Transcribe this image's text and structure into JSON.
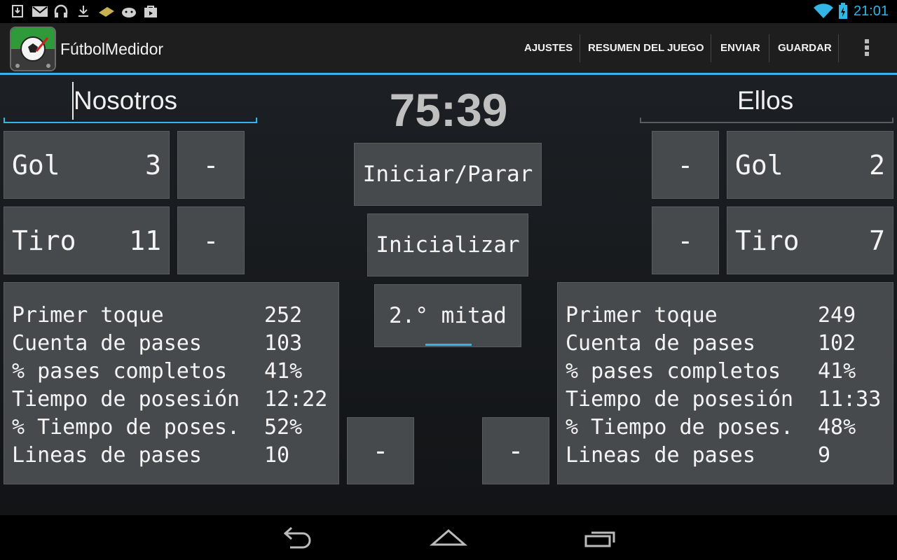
{
  "status_bar": {
    "time": "21:01",
    "left_icons": [
      "download-complete-icon",
      "gmail-icon",
      "headphones-icon",
      "download-icon",
      "mail-stack-icon",
      "android-icon",
      "shopping-bag-icon"
    ],
    "right_icons": [
      "wifi-icon",
      "battery-charging-icon"
    ]
  },
  "action_bar": {
    "title": "FútbolMedidor",
    "actions": [
      "AJUSTES",
      "RESUMEN DEL JUEGO",
      "ENVIAR",
      "GUARDAR"
    ],
    "overflow": "overflow-menu-icon"
  },
  "home": {
    "name": "Nosotros",
    "gol_label": "Gol",
    "gol": "3",
    "tiro_label": "Tiro",
    "tiro": "11",
    "minus": "-"
  },
  "away": {
    "name": "Ellos",
    "gol_label": "Gol",
    "gol": "2",
    "tiro_label": "Tiro",
    "tiro": "7",
    "minus": "-"
  },
  "center": {
    "timer": "75:39",
    "start_stop": "Iniciar/Parar",
    "reset": "Inicializar",
    "half": "2.° mitad",
    "minus_left": "-",
    "minus_right": "-"
  },
  "stats_labels": [
    "Primer toque",
    "Cuenta de pases",
    "% pases completos",
    "Tiempo de posesión",
    "% Tiempo de poses.",
    "Lineas de pases"
  ],
  "home_stats": [
    "252",
    "103",
    "41%",
    "12:22",
    "52%",
    "10"
  ],
  "away_stats": [
    "249",
    "102",
    "41%",
    "11:33",
    "48%",
    "9"
  ],
  "colors": {
    "accent": "#33b5e5",
    "button": "#474a4c",
    "background": "#1c1f23"
  }
}
